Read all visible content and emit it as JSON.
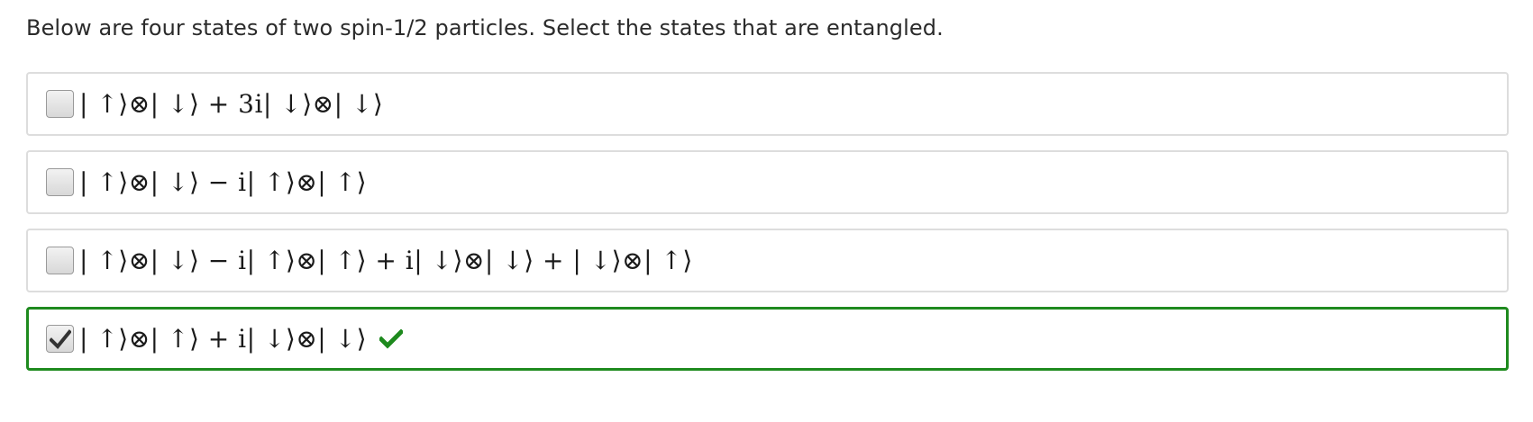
{
  "question": {
    "prompt": "Below are four states of two spin-1/2 particles. Select the states that are entangled."
  },
  "options": [
    {
      "label": "| ↑⟩⊗| ↓⟩ + 3i| ↓⟩⊗| ↓⟩",
      "checked": false,
      "status": "none"
    },
    {
      "label": "| ↑⟩⊗| ↓⟩ − i| ↑⟩⊗| ↑⟩",
      "checked": false,
      "status": "none"
    },
    {
      "label": "| ↑⟩⊗| ↓⟩ − i| ↑⟩⊗| ↑⟩ + i| ↓⟩⊗| ↓⟩ + | ↓⟩⊗| ↑⟩",
      "checked": false,
      "status": "none"
    },
    {
      "label": "| ↑⟩⊗| ↑⟩ + i| ↓⟩⊗| ↓⟩",
      "checked": true,
      "status": "correct",
      "status_icon": "checkmark-icon"
    }
  ],
  "colors": {
    "correct": "#1e8a1e",
    "option_border": "#dddddd"
  }
}
